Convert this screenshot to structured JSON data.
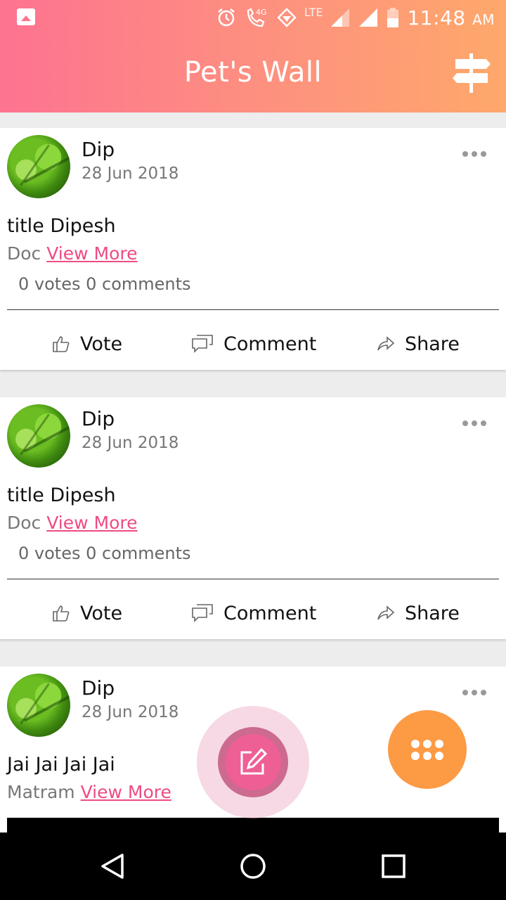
{
  "status_bar": {
    "network": "4G",
    "lte": "LTE",
    "time": "11:48",
    "ampm": "AM"
  },
  "header": {
    "title": "Pet's Wall"
  },
  "posts": [
    {
      "author": "Dip",
      "date": "28 Jun 2018",
      "title": "title Dipesh",
      "body": "Doc",
      "view_more": "View More",
      "stats": "0 votes 0 comments"
    },
    {
      "author": "Dip",
      "date": "28 Jun 2018",
      "title": "title Dipesh",
      "body": "Doc",
      "view_more": "View More",
      "stats": "0 votes 0 comments"
    },
    {
      "author": "Dip",
      "date": "28 Jun 2018",
      "title": "Jai Jai Jai Jai",
      "body": "Matram",
      "view_more": "View More"
    }
  ],
  "actions": {
    "vote": "Vote",
    "comment": "Comment",
    "share": "Share"
  },
  "icons": {
    "header_right": "signpost-icon",
    "fab_primary": "edit-icon",
    "fab_secondary": "apps-grid-icon",
    "nav": [
      "back-icon",
      "home-icon",
      "recents-icon"
    ]
  },
  "colors": {
    "header_gradient_start": "#fd7390",
    "header_gradient_end": "#fea86b",
    "link": "#ef4b84",
    "fab_edit": "#ee5f95",
    "fab_menu": "#fd9a44"
  }
}
